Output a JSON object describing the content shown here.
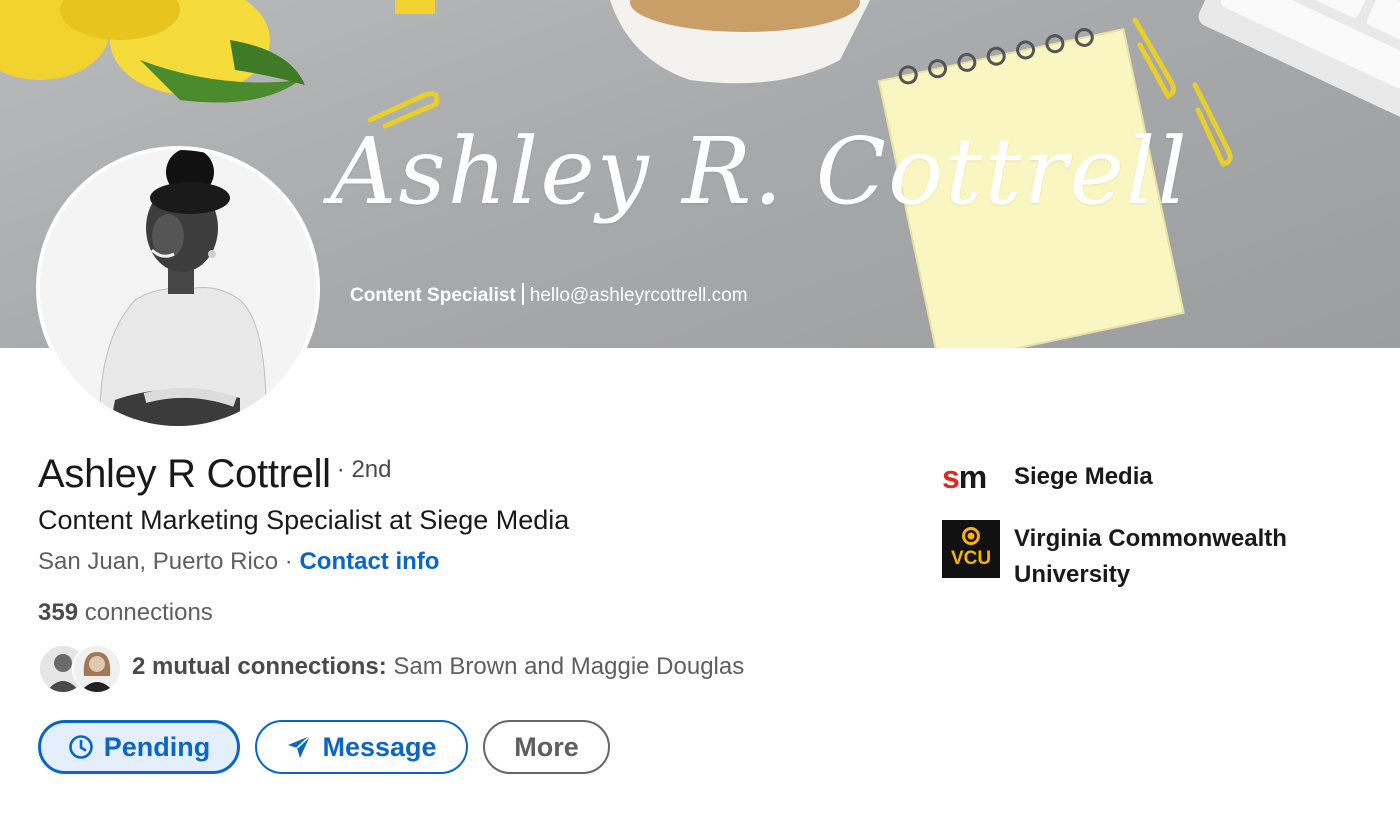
{
  "banner": {
    "signature_name": "Ashley R. Cottrell",
    "tagline_role": "Content Specialist",
    "tagline_email": "hello@ashleyrcottrell.com"
  },
  "profile": {
    "name": "Ashley R Cottrell",
    "degree": "· 2nd",
    "headline": "Content Marketing Specialist at Siege Media",
    "location": "San Juan, Puerto Rico",
    "location_separator": " · ",
    "contact_info": "Contact info",
    "connections_count": "359",
    "connections_label": "connections",
    "mutual_label": "2 mutual connections:",
    "mutual_names": "Sam Brown and Maggie Douglas"
  },
  "actions": {
    "pending": "Pending",
    "message": "Message",
    "more": "More"
  },
  "sidebar": {
    "company": {
      "name": "Siege Media",
      "logo_text_s": "s",
      "logo_text_m": "m"
    },
    "school": {
      "name_line1": "Virginia Commonwealth",
      "name_line2": "University",
      "logo_text": "VCU"
    }
  },
  "colors": {
    "link_blue": "#0a66c2",
    "pending_bg": "#e3effc",
    "siege_red": "#e0261d",
    "vcu_gold": "#f8b300"
  },
  "icons": {
    "pending": "clock-icon",
    "message": "paper-plane-icon"
  }
}
